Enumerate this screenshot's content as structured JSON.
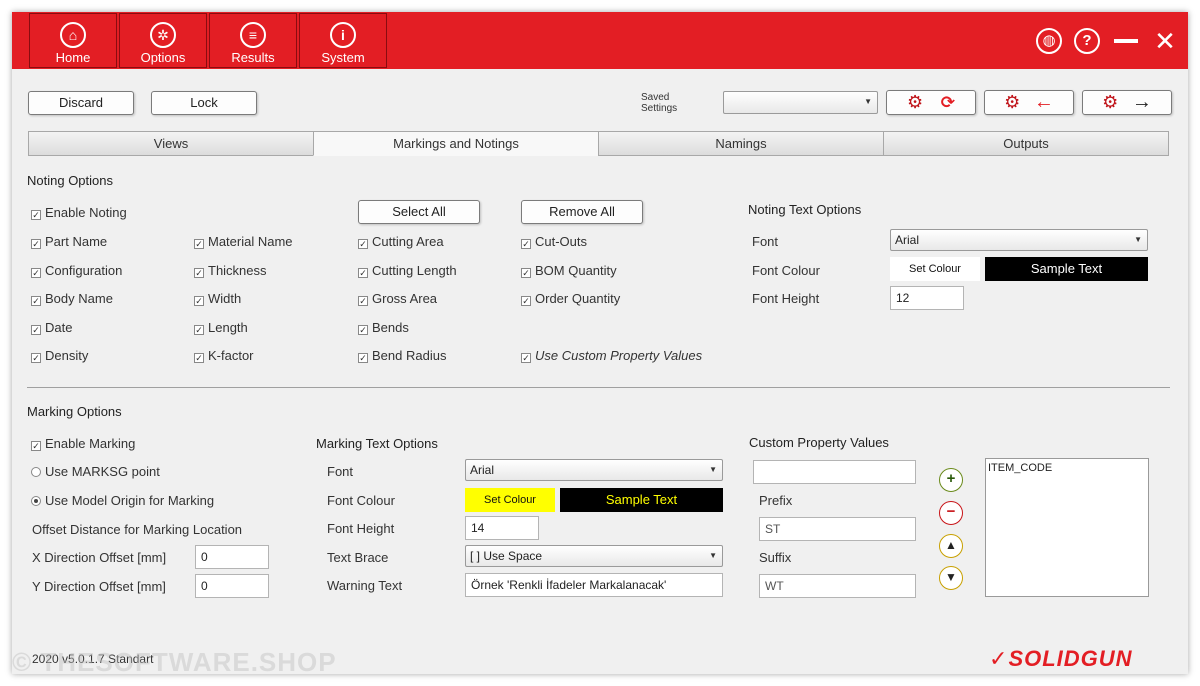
{
  "nav": {
    "home": "Home",
    "options": "Options",
    "results": "Results",
    "system": "System"
  },
  "toolbar": {
    "discard": "Discard",
    "lock": "Lock",
    "saved_settings_line1": "Saved",
    "saved_settings_line2": "Settings",
    "saved_settings_value": ""
  },
  "tabs": [
    "Views",
    "Markings and Notings",
    "Namings",
    "Outputs"
  ],
  "noting": {
    "title": "Noting Options",
    "select_all": "Select All",
    "remove_all": "Remove All",
    "enable": "Enable Noting",
    "col1": [
      "Part Name",
      "Configuration",
      "Body Name",
      "Date",
      "Density"
    ],
    "col2": [
      "Material Name",
      "Thickness",
      "Width",
      "Length",
      "K-factor"
    ],
    "col3": [
      "Cutting Area",
      "Cutting Length",
      "Gross Area",
      "Bends",
      "Bend Radius"
    ],
    "col4": [
      "Cut-Outs",
      "BOM Quantity",
      "Order Quantity"
    ],
    "use_custom": "Use Custom Property Values",
    "text_options": {
      "title": "Noting Text Options",
      "font_label": "Font",
      "font_value": "Arial",
      "colour_label": "Font Colour",
      "set_colour": "Set Colour",
      "sample": "Sample Text",
      "height_label": "Font Height",
      "height_value": "12"
    }
  },
  "marking": {
    "title": "Marking Options",
    "enable": "Enable Marking",
    "radio1": "Use MARKSG point",
    "radio2": "Use Model Origin for Marking",
    "offset_title": "Offset Distance for Marking Location",
    "x_label": "X Direction Offset [mm]",
    "x_value": "0",
    "y_label": "Y Direction Offset [mm]",
    "y_value": "0",
    "text_options": {
      "title": "Marking Text Options",
      "font_label": "Font",
      "font_value": "Arial",
      "colour_label": "Font Colour",
      "set_colour": "Set Colour",
      "sample": "Sample Text",
      "height_label": "Font Height",
      "height_value": "14",
      "brace_label": "Text Brace",
      "brace_value": "[  ] Use Space",
      "warning_label": "Warning Text",
      "warning_value": "Örnek 'Renkli İfadeler Markalanacak'"
    },
    "custom": {
      "title": "Custom Property Values",
      "input_value": "",
      "prefix_label": "Prefix",
      "prefix_value": "ST",
      "suffix_label": "Suffix",
      "suffix_value": "WT",
      "list_items": [
        "ITEM_CODE"
      ]
    }
  },
  "footer": {
    "version": "2020 v5.0.1.7 Standart",
    "watermark": "© THESOFTWARE.SHOP",
    "logo": "SOLIDGUN"
  },
  "colors": {
    "brand_red": "#e31e24",
    "marking_swatch": "#ffff00",
    "noting_swatch": "#ffffff",
    "marking_sample_text": "#ffff00",
    "noting_sample_text": "#ffffff"
  }
}
